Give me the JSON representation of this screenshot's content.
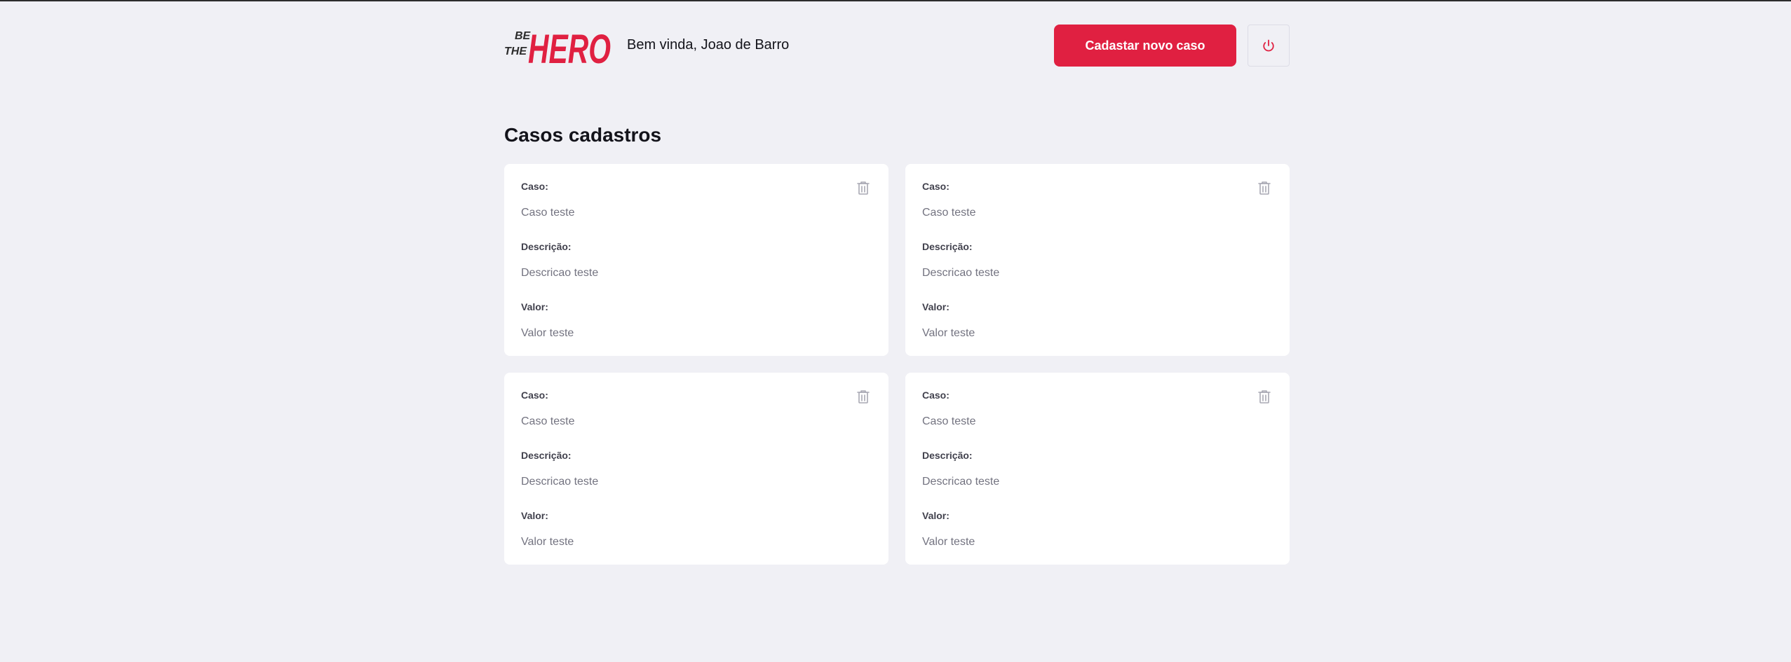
{
  "header": {
    "logo": {
      "line1": "BE",
      "line2": "THE",
      "word": "HERO"
    },
    "welcome_text": "Bem vinda, Joao de Barro",
    "new_case_button": "Cadastar novo caso",
    "logout_icon": "power-icon"
  },
  "main": {
    "title": "Casos cadastros",
    "cases": [
      {
        "case_label": "Caso:",
        "case_value": "Caso teste",
        "description_label": "Descrição:",
        "description_value": "Descricao teste",
        "value_label": "Valor:",
        "value_value": "Valor teste",
        "delete_icon": "trash-icon"
      },
      {
        "case_label": "Caso:",
        "case_value": "Caso teste",
        "description_label": "Descrição:",
        "description_value": "Descricao teste",
        "value_label": "Valor:",
        "value_value": "Valor teste",
        "delete_icon": "trash-icon"
      },
      {
        "case_label": "Caso:",
        "case_value": "Caso teste",
        "description_label": "Descrição:",
        "description_value": "Descricao teste",
        "value_label": "Valor:",
        "value_value": "Valor teste",
        "delete_icon": "trash-icon"
      },
      {
        "case_label": "Caso:",
        "case_value": "Caso teste",
        "description_label": "Descrição:",
        "description_value": "Descricao teste",
        "value_label": "Valor:",
        "value_value": "Valor teste",
        "delete_icon": "trash-icon"
      }
    ]
  },
  "colors": {
    "background": "#f0f0f5",
    "accent": "#e02041",
    "card": "#ffffff",
    "label": "#41414d",
    "value": "#737380",
    "heading": "#13131a",
    "logo_dark": "#2c2c2c",
    "icon_muted": "#a8a8b3"
  }
}
